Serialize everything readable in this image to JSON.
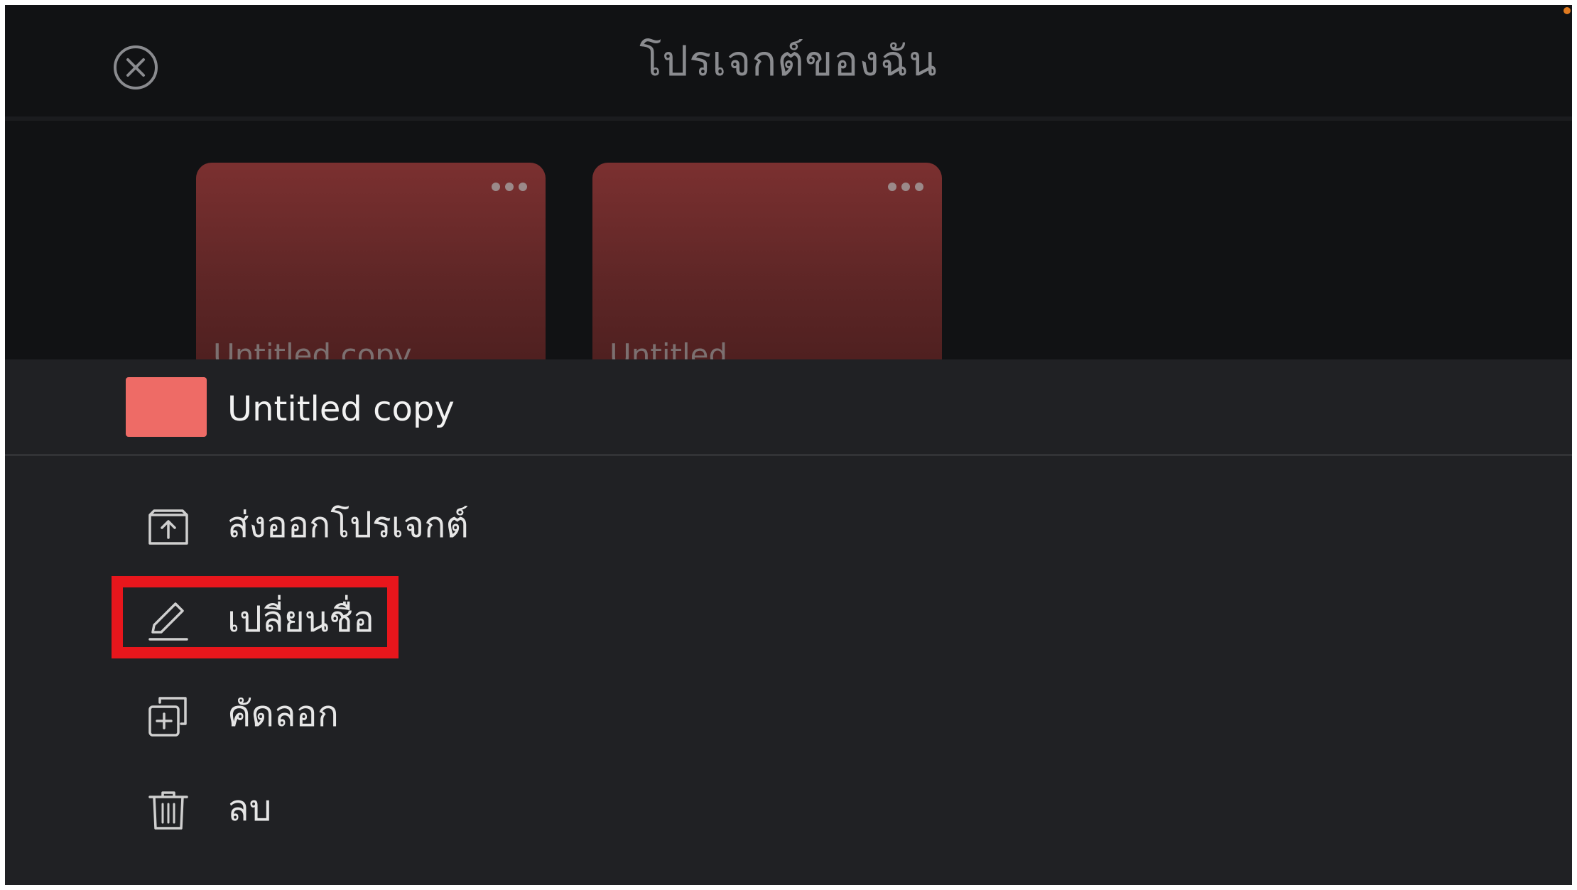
{
  "colors": {
    "screen_bg": "#111214",
    "sheet_bg": "#202124",
    "card_top": "#7b3030",
    "card_bottom": "#4f2020",
    "swatch": "#ee6b66",
    "highlight": "#e8161c",
    "status_dot": "#e07a20"
  },
  "header": {
    "title": "โปรเจกต์ของฉัน",
    "close_icon": "close-circle-icon"
  },
  "projects": [
    {
      "label": "Untitled copy"
    },
    {
      "label": "Untitled"
    }
  ],
  "sheet": {
    "title": "Untitled copy",
    "items": [
      {
        "label": "ส่งออกโปรเจกต์",
        "icon": "export-icon"
      },
      {
        "label": "เปลี่ยนชื่อ",
        "icon": "pencil-icon",
        "highlighted": true
      },
      {
        "label": "คัดลอก",
        "icon": "duplicate-icon"
      },
      {
        "label": "ลบ",
        "icon": "trash-icon"
      }
    ]
  }
}
